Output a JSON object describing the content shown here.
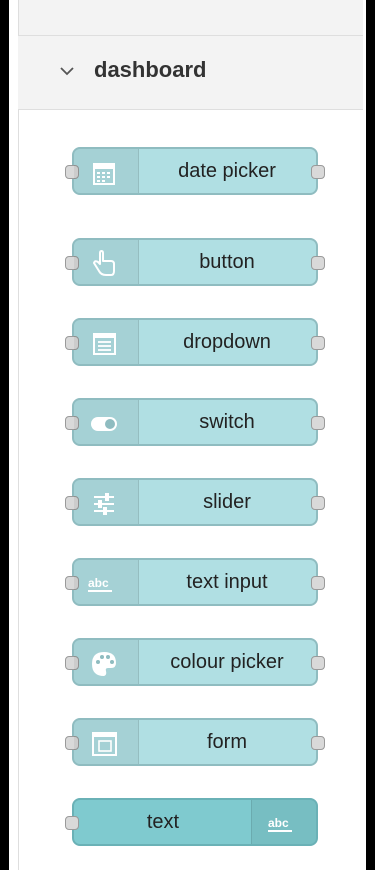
{
  "palette": {
    "category": {
      "title": "dashboard"
    },
    "nodes": [
      {
        "label": "date picker",
        "icon": "calendar-icon"
      },
      {
        "label": "button",
        "icon": "hand-pointer-icon"
      },
      {
        "label": "dropdown",
        "icon": "list-icon"
      },
      {
        "label": "switch",
        "icon": "toggle-icon"
      },
      {
        "label": "slider",
        "icon": "sliders-icon"
      },
      {
        "label": "text input",
        "icon": "abc-icon"
      },
      {
        "label": "colour picker",
        "icon": "palette-icon"
      },
      {
        "label": "form",
        "icon": "form-icon"
      },
      {
        "label": "text",
        "icon": "abc-icon"
      }
    ],
    "colors": {
      "node_fill": "#b0dfe3",
      "output_node_fill": "#7fcacf",
      "port": "#d9d9d9"
    }
  }
}
